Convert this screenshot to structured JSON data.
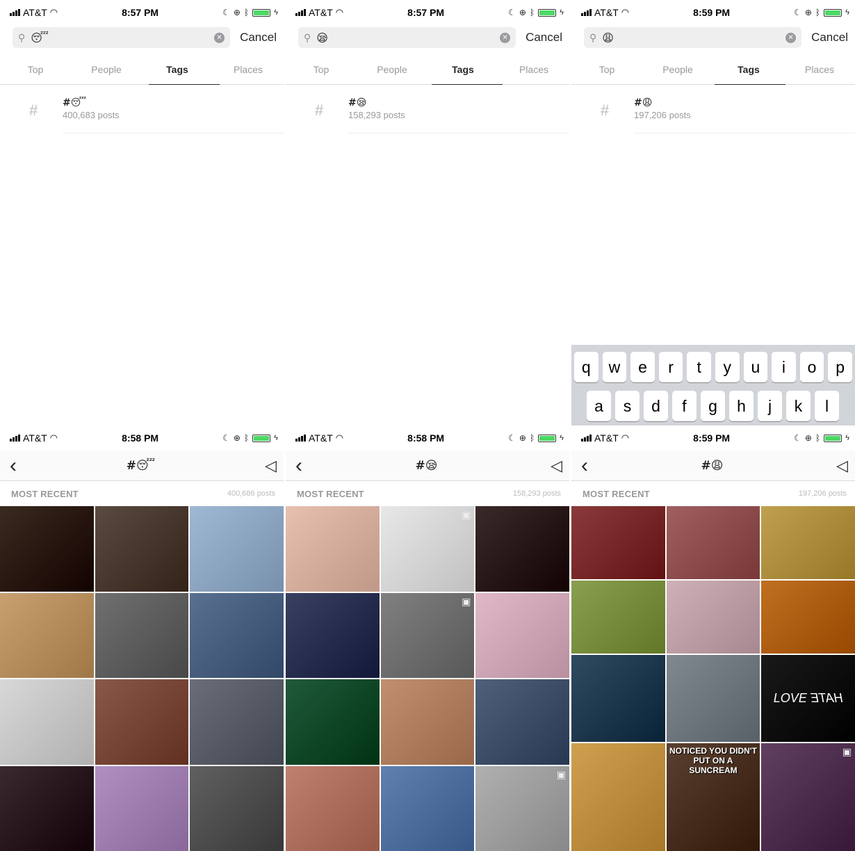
{
  "status": {
    "carrier": "AT&T"
  },
  "search": {
    "cancel": "Cancel"
  },
  "tabs": [
    "Top",
    "People",
    "Tags",
    "Places"
  ],
  "panels_top": [
    {
      "time": "8:57 PM",
      "query": "😴",
      "tag": "#😴",
      "count": "400,683 posts"
    },
    {
      "time": "8:57 PM",
      "query": "😪",
      "tag": "#😪",
      "count": "158,293 posts"
    },
    {
      "time": "8:59 PM",
      "query": "😩",
      "tag": "#😩",
      "count": "197,206 posts"
    }
  ],
  "keyboard": {
    "row1": [
      "q",
      "w",
      "e",
      "r",
      "t",
      "y",
      "u",
      "i",
      "o",
      "p"
    ],
    "row2": [
      "a",
      "s",
      "d",
      "f",
      "g",
      "h",
      "j",
      "k",
      "l"
    ]
  },
  "panels_bottom": [
    {
      "time": "8:58 PM",
      "title": "#😴",
      "section": "MOST RECENT",
      "count": "400,686 posts"
    },
    {
      "time": "8:58 PM",
      "title": "#😪",
      "section": "MOST RECENT",
      "count": "158,293 posts"
    },
    {
      "time": "8:59 PM",
      "title": "#😩",
      "section": "MOST RECENT",
      "count": "197,206 posts"
    }
  ],
  "grid_captions": {
    "suncream": "NOTICED YOU DIDN'T PUT ON A SUNCREAM",
    "love": "LOVE",
    "hate": "HATE"
  },
  "colors": {
    "grid1": [
      "#3b2a1f",
      "#5a4a40",
      "#9fb8d4",
      "#c8a070",
      "#707070",
      "#5a7090",
      "#d8d8d8",
      "#8a5848",
      "#6a6e78",
      "#3a2a30",
      "#b090c0",
      "#606060"
    ],
    "grid2": [
      "#e8c0b0",
      "#e8e8e8",
      "#3a2a2a",
      "#3a4060",
      "#808080",
      "#e0b8c8",
      "#1f5a3a",
      "#c09070",
      "#50607a",
      "#c08070",
      "#6080b0",
      "#b0b0b0"
    ],
    "grid3": [
      "#8a3a3a",
      "#a06060",
      "#c0a050",
      "#8aa050",
      "#d0b0b8",
      "#c07020",
      "#304a60",
      "#808890",
      "#1a1a1a",
      "#d0a050",
      "#5a4030",
      "#604060"
    ]
  }
}
